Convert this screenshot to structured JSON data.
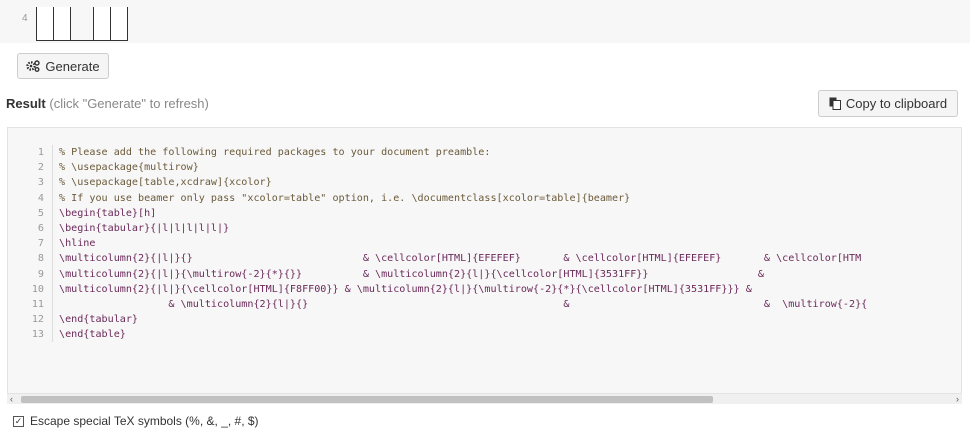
{
  "table_editor": {
    "row_number": "4"
  },
  "generate_button": {
    "label": "Generate",
    "icon": "gears-icon"
  },
  "result": {
    "title": "Result",
    "hint": "(click \"Generate\" to refresh)"
  },
  "copy_button": {
    "label": "Copy to clipboard",
    "icon": "clipboard-icon"
  },
  "code": {
    "lines": [
      {
        "num": "1",
        "text": "% Please add the following required packages to your document preamble:"
      },
      {
        "num": "2",
        "text": "% \\usepackage{multirow}"
      },
      {
        "num": "3",
        "text": "% \\usepackage[table,xcdraw]{xcolor}"
      },
      {
        "num": "4",
        "text": "% If you use beamer only pass \"xcolor=table\" option, i.e. \\documentclass[xcolor=table]{beamer}"
      },
      {
        "num": "5",
        "text": "\\begin{table}[h]"
      },
      {
        "num": "6",
        "text": "\\begin{tabular}{|l|l|l|l|l|}"
      },
      {
        "num": "7",
        "text": "\\hline"
      },
      {
        "num": "8",
        "text": "\\multicolumn{2}{|l|}{}                            & \\cellcolor[HTML]{EFEFEF}       & \\cellcolor[HTML]{EFEFEF}       & \\cellcolor[HTM"
      },
      {
        "num": "9",
        "text": "\\multicolumn{2}{|l|}{\\multirow{-2}{*}{}}          & \\multicolumn{2}{l|}{\\cellcolor[HTML]{3531FF}}                  &"
      },
      {
        "num": "10",
        "text": "\\multicolumn{2}{|l|}{\\cellcolor[HTML]{F8FF00}} & \\multicolumn{2}{l|}{\\multirow{-2}{*}{\\cellcolor[HTML]{3531FF}}} &"
      },
      {
        "num": "11",
        "text": "                  & \\multicolumn{2}{l|}{}                                          &                                &  \\multirow{-2}{"
      },
      {
        "num": "12",
        "text": "\\end{tabular}"
      },
      {
        "num": "13",
        "text": "\\end{table}"
      }
    ]
  },
  "options": {
    "escape_label": "Escape special TeX symbols (%, &, _, #, $)",
    "escape_checked": true
  }
}
